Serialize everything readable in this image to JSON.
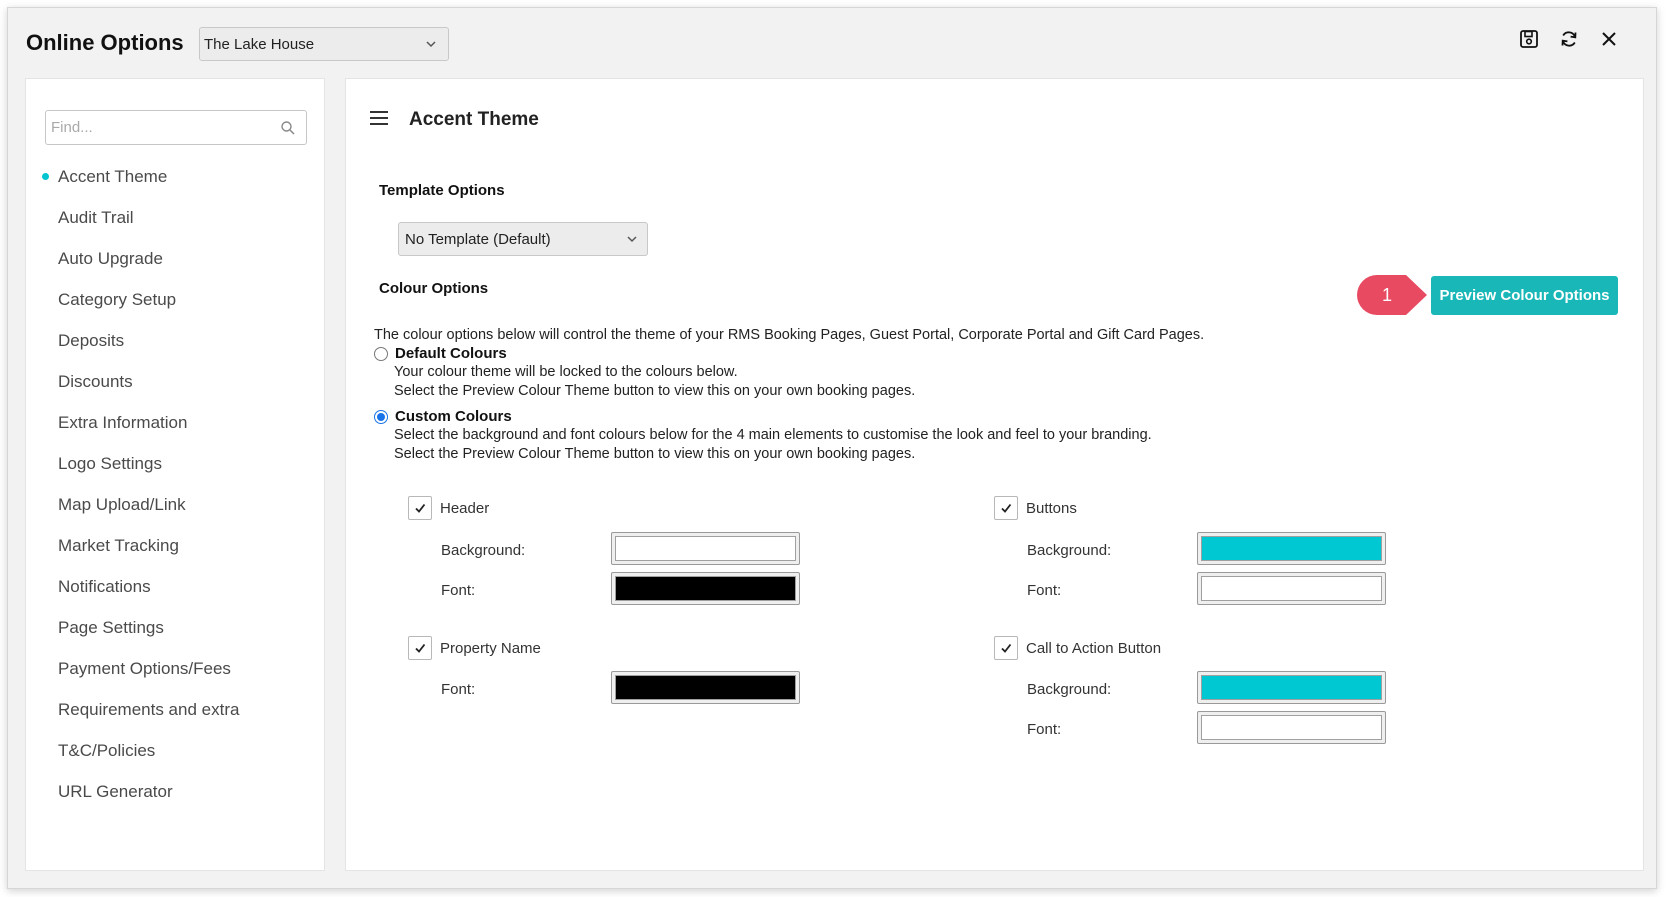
{
  "app": {
    "title": "Online Options",
    "property_selected": "The Lake House"
  },
  "toolbar": {
    "icons": [
      "save-icon",
      "refresh-icon",
      "close-icon"
    ]
  },
  "sidebar": {
    "search_placeholder": "Find...",
    "active_index": 0,
    "items": [
      "Accent Theme",
      "Audit Trail",
      "Auto Upgrade",
      "Category Setup",
      "Deposits",
      "Discounts",
      "Extra Information",
      "Logo Settings",
      "Map Upload/Link",
      "Market Tracking",
      "Notifications",
      "Page Settings",
      "Payment Options/Fees",
      "Requirements and extra",
      "T&C/Policies",
      "URL Generator"
    ]
  },
  "main": {
    "title": "Accent Theme",
    "template": {
      "label": "Template Options",
      "selected": "No Template (Default)"
    },
    "colour": {
      "label": "Colour Options",
      "preview_button": "Preview Colour Options",
      "callout_number": "1",
      "description": "The colour options below will control the theme of your RMS Booking Pages, Guest Portal, Corporate Portal and Gift Card Pages.",
      "default_option": {
        "label": "Default Colours",
        "selected": false,
        "line1": "Your colour theme will be locked to the colours below.",
        "line2": "Select the Preview Colour Theme button to view this on your own booking pages."
      },
      "custom_option": {
        "label": "Custom Colours",
        "selected": true,
        "line1": "Select the background and font colours below for the 4 main elements to customise the look and feel to your branding.",
        "line2": "Select the Preview Colour Theme button to view this on your own booking pages."
      }
    },
    "elements": {
      "header": {
        "label": "Header",
        "checked": true,
        "background_label": "Background:",
        "background": "#ffffff",
        "font_label": "Font:",
        "font": "#000000"
      },
      "property_name": {
        "label": "Property Name",
        "checked": true,
        "font_label": "Font:",
        "font": "#000000"
      },
      "buttons": {
        "label": "Buttons",
        "checked": true,
        "background_label": "Background:",
        "background": "#00c8d2",
        "font_label": "Font:",
        "font": "#ffffff"
      },
      "cta_button": {
        "label": "Call to Action Button",
        "checked": true,
        "background_label": "Background:",
        "background": "#00c8d2",
        "font_label": "Font:",
        "font": "#ffffff"
      }
    }
  },
  "colors": {
    "accent": "#00c4cf",
    "button": "#1ab7b9",
    "callout": "#e84a62"
  }
}
